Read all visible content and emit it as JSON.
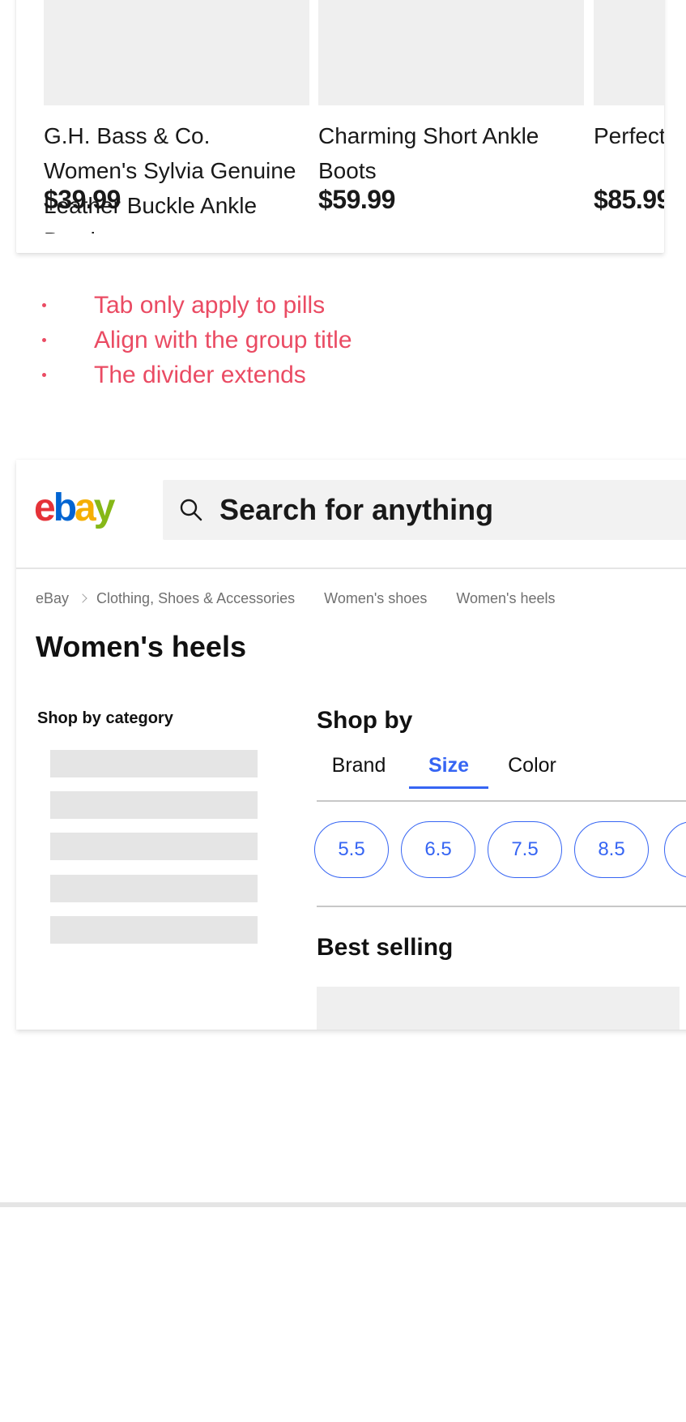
{
  "carousel": {
    "products": [
      {
        "title": "G.H. Bass & Co. Women's Sylvia Genuine Leather Buckle Ankle Bootie",
        "price": "$39.99"
      },
      {
        "title": "Charming Short Ankle Boots",
        "price": "$59.99"
      },
      {
        "title": "Perfect Summer Sandals",
        "price": "$85.99"
      }
    ]
  },
  "notes": [
    "Tab only apply to pills",
    "Align with the group title",
    "The divider extends"
  ],
  "header": {
    "logo": {
      "e": "e",
      "b": "b",
      "a": "a",
      "y": "y"
    },
    "search_placeholder": "Search for anything"
  },
  "breadcrumb": [
    "eBay",
    "Clothing, Shoes & Accessories",
    "Women's shoes",
    "Women's heels"
  ],
  "page_title": "Women's heels",
  "sidebar": {
    "title": "Shop by category"
  },
  "shop_by": {
    "title": "Shop by",
    "tabs": [
      "Brand",
      "Size",
      "Color"
    ],
    "active_tab": "Size",
    "pills": [
      "5.5",
      "6.5",
      "7.5",
      "8.5",
      ""
    ]
  },
  "best_selling": {
    "title": "Best selling"
  },
  "colors": {
    "accent": "#3665f3",
    "annotation": "#ea4b63",
    "logo_red": "#e53238",
    "logo_blue": "#0064d2",
    "logo_yellow": "#f5af02",
    "logo_green": "#86b817"
  }
}
